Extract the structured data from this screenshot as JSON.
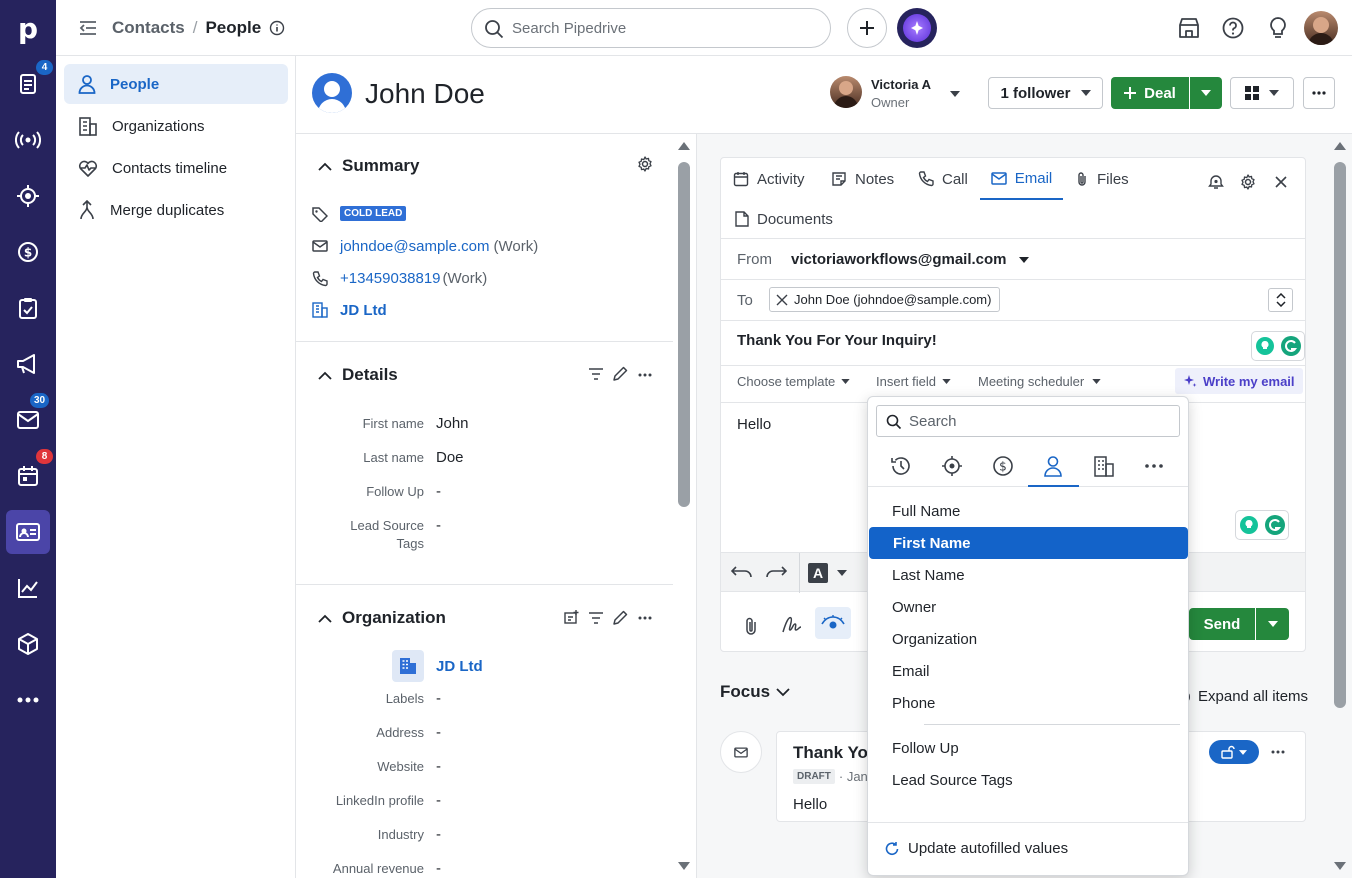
{
  "rail": {
    "badges": {
      "activities": "4",
      "mail": "30",
      "calendar": "8"
    }
  },
  "header": {
    "breadcrumb_parent": "Contacts",
    "breadcrumb_sep": "/",
    "breadcrumb_current": "People",
    "search_placeholder": "Search Pipedrive"
  },
  "leftnav": {
    "items": [
      {
        "label": "People"
      },
      {
        "label": "Organizations"
      },
      {
        "label": "Contacts timeline"
      },
      {
        "label": "Merge duplicates"
      }
    ]
  },
  "person": {
    "name": "John Doe",
    "owner_name": "Victoria A",
    "owner_role": "Owner",
    "followers": "1 follower",
    "deal_button": "Deal"
  },
  "summary": {
    "title": "Summary",
    "label_tag": "COLD LEAD",
    "email": "johndoe@sample.com",
    "email_type": "(Work)",
    "phone": "+13459038819",
    "phone_type": "(Work)",
    "org": "JD Ltd"
  },
  "details": {
    "title": "Details",
    "fields": [
      {
        "label": "First name",
        "value": "John"
      },
      {
        "label": "Last name",
        "value": "Doe"
      },
      {
        "label": "Follow Up",
        "value": "-"
      },
      {
        "label": "Lead Source Tags",
        "value": "-"
      }
    ]
  },
  "organization": {
    "title": "Organization",
    "name": "JD Ltd",
    "fields": [
      {
        "label": "Labels",
        "value": "-"
      },
      {
        "label": "Address",
        "value": "-"
      },
      {
        "label": "Website",
        "value": "-"
      },
      {
        "label": "LinkedIn profile",
        "value": "-"
      },
      {
        "label": "Industry",
        "value": "-"
      },
      {
        "label": "Annual revenue",
        "value": "-"
      }
    ]
  },
  "composer": {
    "tabs": [
      "Activity",
      "Notes",
      "Call",
      "Email",
      "Files",
      "Documents"
    ],
    "from_label": "From",
    "from_value": "victoriaworkflows@gmail.com",
    "to_label": "To",
    "to_chip": "John Doe (johndoe@sample.com)",
    "subject": "Thank You For Your Inquiry!",
    "choose_template": "Choose template",
    "insert_field": "Insert field",
    "meeting_scheduler": "Meeting scheduler",
    "write_my_email": "Write my email",
    "body": "Hello",
    "send": "Send"
  },
  "focus": {
    "title": "Focus",
    "expand_all": "Expand all items",
    "card_title": "Thank You",
    "card_badge": "DRAFT",
    "card_meta": "· Jan",
    "card_body": "Hello"
  },
  "dropdown": {
    "search_placeholder": "Search",
    "items": [
      "Full Name",
      "First Name",
      "Last Name",
      "Owner",
      "Organization",
      "Email",
      "Phone"
    ],
    "items2": [
      "Follow Up",
      "Lead Source Tags"
    ],
    "selected": "First Name",
    "footer": "Update autofilled values"
  },
  "colors": {
    "rail": "#26235d",
    "accent_blue": "#1a66c6",
    "deal_green": "#25883d",
    "selected": "#1363c9"
  }
}
